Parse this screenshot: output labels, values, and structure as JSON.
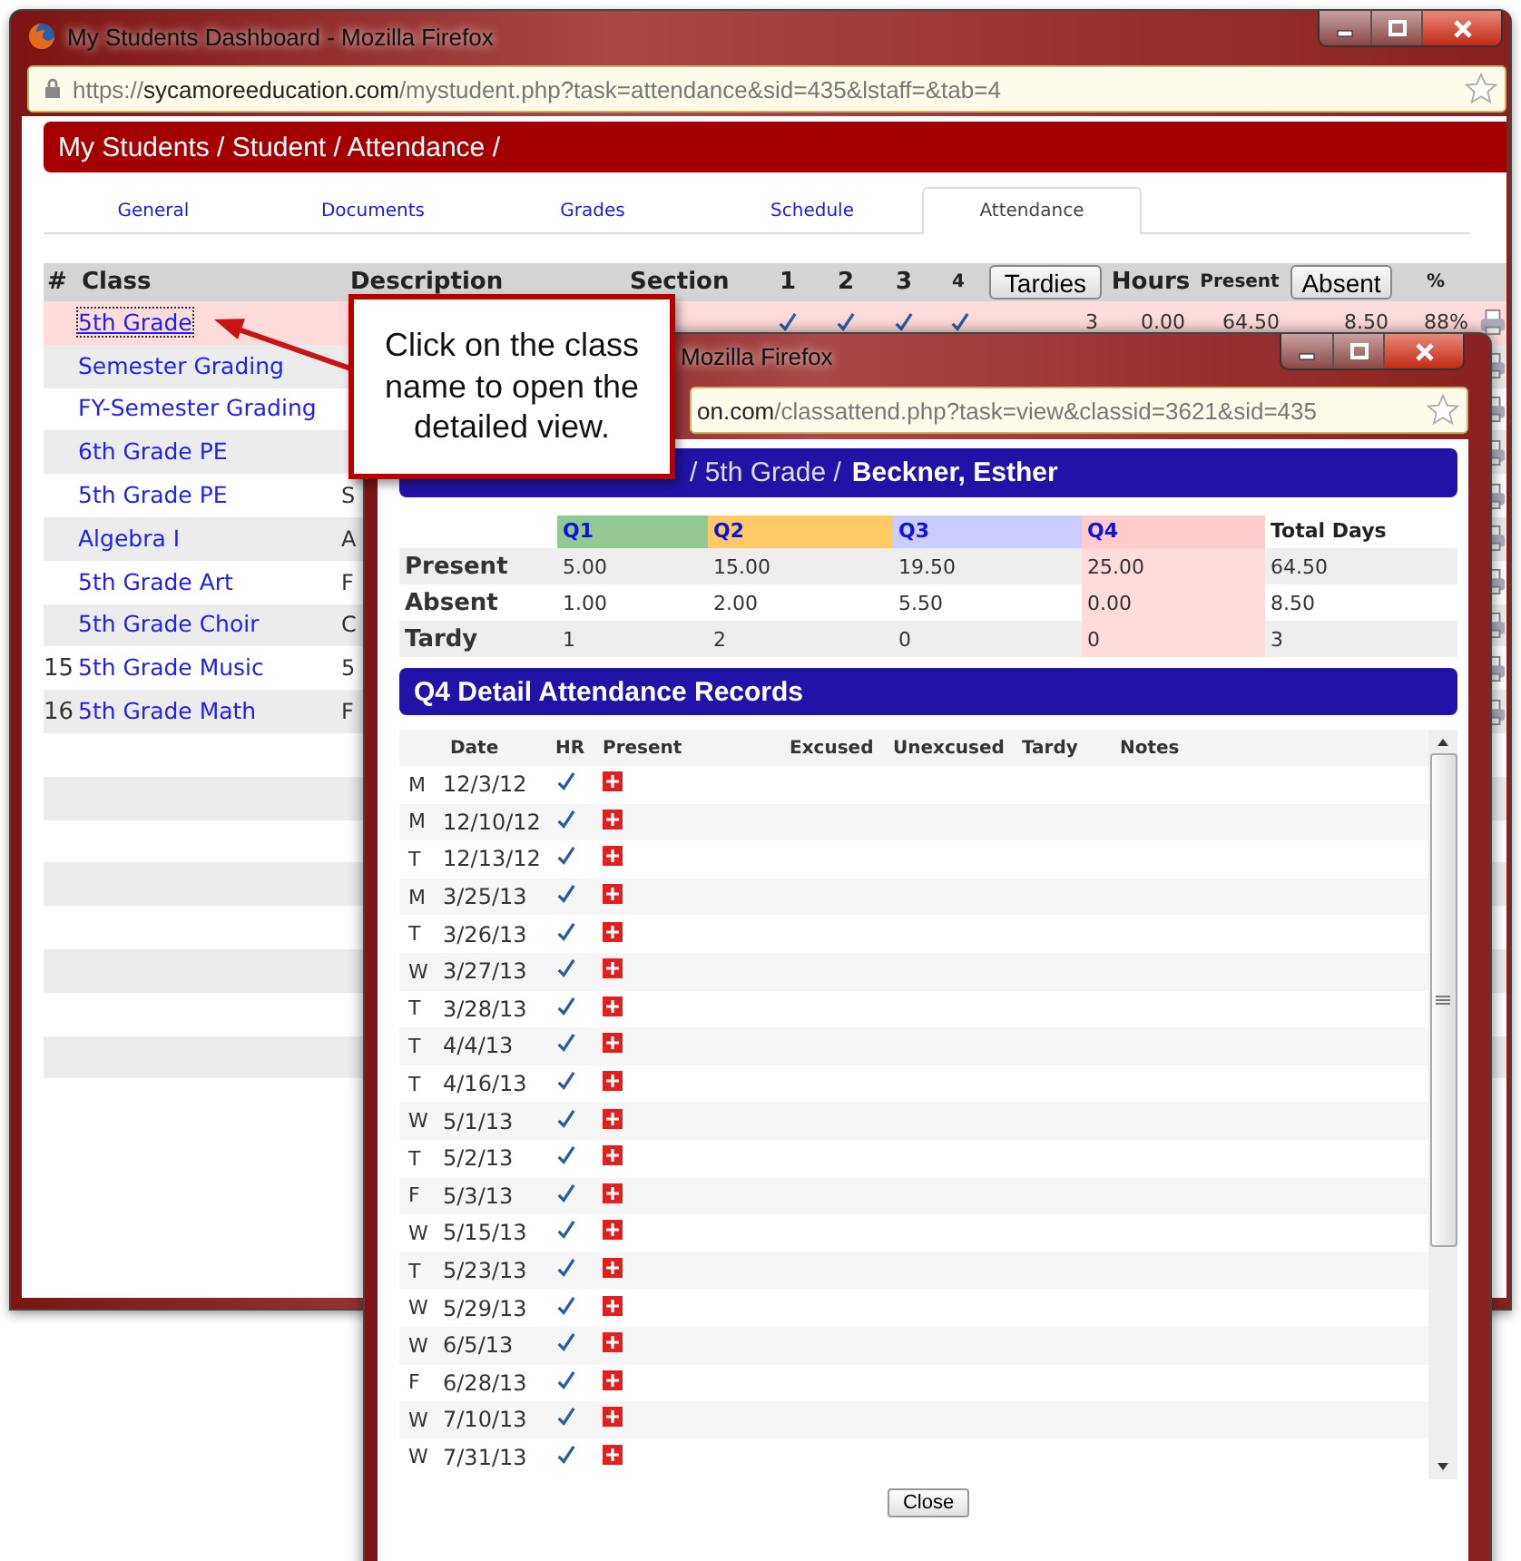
{
  "main_window": {
    "title": "My Students Dashboard - Mozilla Firefox",
    "url": {
      "scheme": "https://",
      "host": "sycamoreeducation.com",
      "path": "/mystudent.php?task=attendance&sid=435&lstaff=&tab=4"
    },
    "breadcrumb": "My Students / Student / Attendance /",
    "tabs": [
      {
        "label": "General",
        "selected": false
      },
      {
        "label": "Documents",
        "selected": false
      },
      {
        "label": "Grades",
        "selected": false
      },
      {
        "label": "Schedule",
        "selected": false
      },
      {
        "label": "Attendance",
        "selected": true
      }
    ],
    "table": {
      "columns": [
        {
          "label": "#",
          "kind": "text"
        },
        {
          "label": "Class",
          "kind": "text"
        },
        {
          "label": "Description",
          "kind": "text"
        },
        {
          "label": "Section",
          "kind": "text"
        },
        {
          "label": "1",
          "kind": "text"
        },
        {
          "label": "2",
          "kind": "text"
        },
        {
          "label": "3",
          "kind": "text"
        },
        {
          "label": "4",
          "kind": "small"
        },
        {
          "label": "Tardies",
          "kind": "button"
        },
        {
          "label": "Hours",
          "kind": "text"
        },
        {
          "label": "Present",
          "kind": "small"
        },
        {
          "label": "Absent",
          "kind": "button"
        },
        {
          "label": "%",
          "kind": "small"
        }
      ],
      "rows": [
        {
          "number": "",
          "class": "5th Grade",
          "description": "",
          "selected": true,
          "focused": true,
          "checks": [
            true,
            true,
            true,
            true
          ],
          "tardies": "3",
          "hours": "0.00",
          "present": "64.50",
          "absent": "8.50",
          "percent": "88%"
        },
        {
          "number": "",
          "class": "Semester Grading",
          "description": "",
          "selected": false,
          "focused": false
        },
        {
          "number": "",
          "class": "FY-Semester Grading",
          "description": "",
          "selected": false,
          "focused": false
        },
        {
          "number": "",
          "class": "6th Grade PE",
          "description": "",
          "selected": false,
          "focused": false
        },
        {
          "number": "",
          "class": "5th Grade PE",
          "description": "S",
          "selected": false,
          "focused": false
        },
        {
          "number": "",
          "class": "Algebra I",
          "description": "A",
          "selected": false,
          "focused": false
        },
        {
          "number": "",
          "class": "5th Grade Art",
          "description": "F",
          "selected": false,
          "focused": false
        },
        {
          "number": "",
          "class": "5th Grade Choir",
          "description": "C",
          "selected": false,
          "focused": false
        },
        {
          "number": "15",
          "class": "5th Grade Music",
          "description": "5",
          "selected": false,
          "focused": false
        },
        {
          "number": "16",
          "class": "5th Grade Math",
          "description": "F",
          "selected": false,
          "focused": false
        }
      ]
    }
  },
  "popup_window": {
    "title": "Mozilla Firefox",
    "url": {
      "host": "on.com",
      "path": "/classattend.php?task=view&classid=3621&sid=435"
    },
    "breadcrumb": {
      "path": "/ 5th Grade /",
      "student": "Beckner, Esther"
    },
    "summary": {
      "quarters": [
        {
          "label": "Q1",
          "color": "#92c992",
          "selected": false
        },
        {
          "label": "Q2",
          "color": "#ffc966",
          "selected": false
        },
        {
          "label": "Q3",
          "color": "#ccccff",
          "selected": false
        },
        {
          "label": "Q4",
          "color": "#ffcccc",
          "selected": true
        }
      ],
      "total_label": "Total Days",
      "rows": [
        {
          "label": "Present",
          "values": [
            "5.00",
            "15.00",
            "19.50",
            "25.00"
          ],
          "total": "64.50"
        },
        {
          "label": "Absent",
          "values": [
            "1.00",
            "2.00",
            "5.50",
            "0.00"
          ],
          "total": "8.50"
        },
        {
          "label": "Tardy",
          "values": [
            "1",
            "2",
            "0",
            "0"
          ],
          "total": "3"
        }
      ]
    },
    "detail": {
      "title": "Q4 Detail Attendance Records",
      "columns": [
        "Date",
        "HR",
        "Present",
        "Excused",
        "Unexcused",
        "Tardy",
        "Notes"
      ],
      "records": [
        {
          "day": "M",
          "date": "12/3/12",
          "hr": true,
          "present": true
        },
        {
          "day": "M",
          "date": "12/10/12",
          "hr": true,
          "present": true
        },
        {
          "day": "T",
          "date": "12/13/12",
          "hr": true,
          "present": true
        },
        {
          "day": "M",
          "date": "3/25/13",
          "hr": true,
          "present": true
        },
        {
          "day": "T",
          "date": "3/26/13",
          "hr": true,
          "present": true
        },
        {
          "day": "W",
          "date": "3/27/13",
          "hr": true,
          "present": true
        },
        {
          "day": "T",
          "date": "3/28/13",
          "hr": true,
          "present": true
        },
        {
          "day": "T",
          "date": "4/4/13",
          "hr": true,
          "present": true
        },
        {
          "day": "T",
          "date": "4/16/13",
          "hr": true,
          "present": true
        },
        {
          "day": "W",
          "date": "5/1/13",
          "hr": true,
          "present": true
        },
        {
          "day": "T",
          "date": "5/2/13",
          "hr": true,
          "present": true
        },
        {
          "day": "F",
          "date": "5/3/13",
          "hr": true,
          "present": true
        },
        {
          "day": "W",
          "date": "5/15/13",
          "hr": true,
          "present": true
        },
        {
          "day": "T",
          "date": "5/23/13",
          "hr": true,
          "present": true
        },
        {
          "day": "W",
          "date": "5/29/13",
          "hr": true,
          "present": true
        },
        {
          "day": "W",
          "date": "6/5/13",
          "hr": true,
          "present": true
        },
        {
          "day": "F",
          "date": "6/28/13",
          "hr": true,
          "present": true
        },
        {
          "day": "W",
          "date": "7/10/13",
          "hr": true,
          "present": true
        },
        {
          "day": "W",
          "date": "7/31/13",
          "hr": true,
          "present": true
        }
      ]
    },
    "close_button": "Close"
  },
  "callout": {
    "text": "Click on the class name to open the detailed view."
  }
}
